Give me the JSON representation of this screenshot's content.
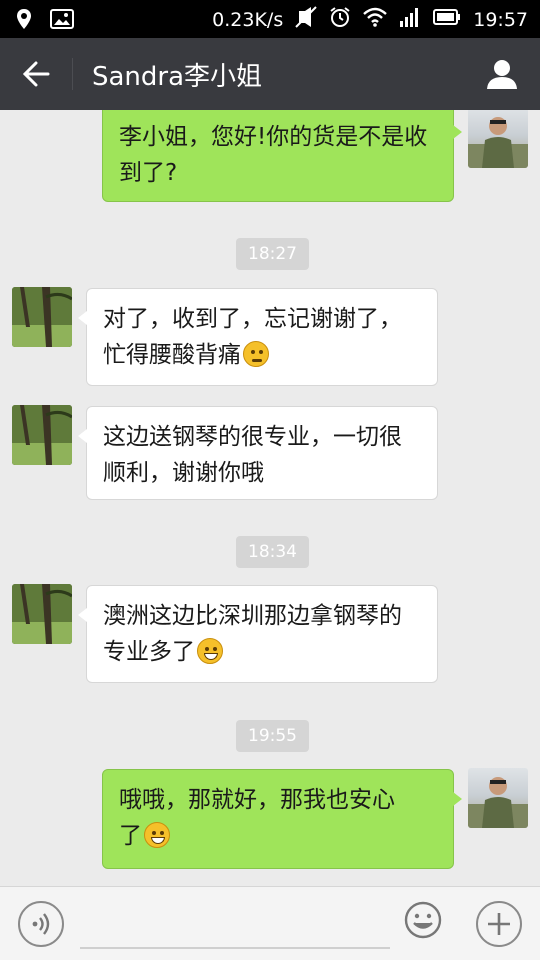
{
  "status_bar": {
    "speed": "0.23K/s",
    "time": "19:57",
    "icons": [
      "location-icon",
      "image-notification-icon",
      "mute-icon",
      "alarm-icon",
      "wifi-icon",
      "signal-icon",
      "battery-icon"
    ]
  },
  "header": {
    "title": "Sandra李小姐",
    "icons": [
      "back-arrow-icon",
      "contact-profile-icon"
    ]
  },
  "messages": [
    {
      "sender": "me",
      "lines": [
        "李小姐，您好!你的货是不是收",
        "到了?"
      ],
      "emoji": ""
    },
    {
      "type": "timestamp",
      "text": "18:27"
    },
    {
      "sender": "them",
      "lines": [
        "对了，收到了，忘记谢谢了，",
        "忙得腰酸背痛"
      ],
      "emoji": "thinking-emoji"
    },
    {
      "sender": "them",
      "lines": [
        "这边送钢琴的很专业，一切很",
        "顺利，谢谢你哦"
      ],
      "emoji": ""
    },
    {
      "type": "timestamp",
      "text": "18:34"
    },
    {
      "sender": "them",
      "lines": [
        "澳洲这边比深圳那边拿钢琴的",
        "专业多了"
      ],
      "emoji": "grin-emoji"
    },
    {
      "type": "timestamp",
      "text": "19:55"
    },
    {
      "sender": "me",
      "lines": [
        "哦哦，那就好，那我也安心",
        "了"
      ],
      "emoji": "grin-emoji"
    }
  ],
  "input_bar": {
    "placeholder": "",
    "icons": [
      "voice-icon",
      "emoji-icon",
      "plus-icon"
    ]
  },
  "colors": {
    "header_bg": "#393a3f",
    "chat_bg": "#ebebeb",
    "my_bubble": "#9fe45a",
    "their_bubble": "#ffffff",
    "timestamp_bg": "#d5d5d5"
  }
}
